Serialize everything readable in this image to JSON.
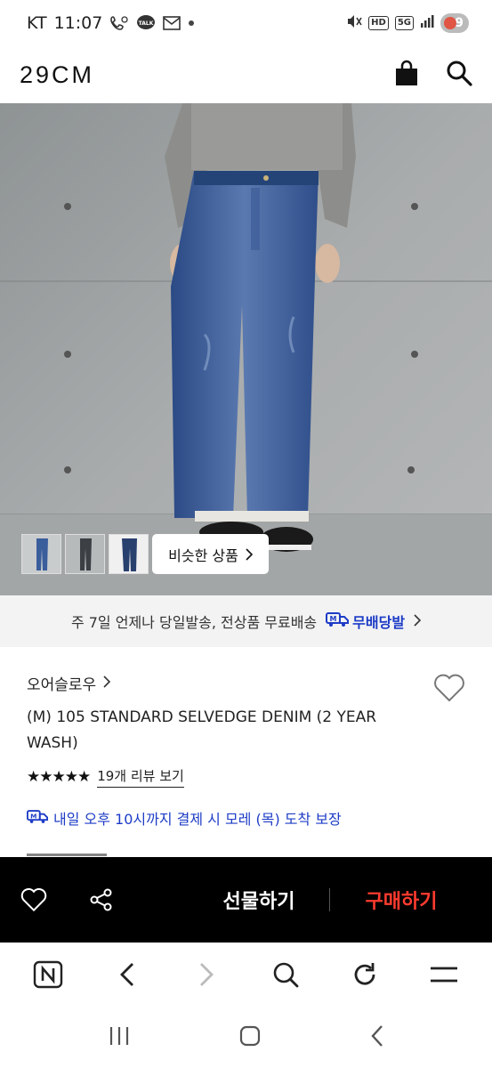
{
  "status_bar": {
    "carrier": "KT",
    "time": "11:07",
    "talk_badge": "TALK",
    "network": "5G",
    "hd_badge": "HD",
    "battery": "9"
  },
  "header": {
    "logo": "29CM",
    "icons": [
      "shopping-bag-icon",
      "search-icon"
    ]
  },
  "hero": {
    "thumbnails": [
      "thumb-blue-jeans",
      "thumb-dark-jeans",
      "thumb-indigo-jeans"
    ],
    "similar_label": "비슷한 상품",
    "similar_chevron": "›"
  },
  "shipping_banner": {
    "text": "주 7일 언제나 당일발송, 전상품 무료배송",
    "brand_label": "무배당발",
    "chevron": "›"
  },
  "product": {
    "brand": "오어슬로우",
    "brand_chevron": "›",
    "title": "(M) 105 STANDARD SELVEDGE DENIM (2 YEAR WASH)",
    "stars": "★★★★★",
    "review_link": "19개 리뷰 보기",
    "delivery_text": "내일 오후 10시까지 결제 시 모레 (목) 도착 보장"
  },
  "action_bar": {
    "gift_label": "선물하기",
    "buy_label": "구매하기"
  },
  "browser_bar": {
    "icons": [
      "naver-icon",
      "back-icon",
      "forward-icon",
      "search-icon",
      "reload-icon",
      "menu-icon"
    ]
  },
  "system_nav": {
    "icons": [
      "recent-apps-icon",
      "home-icon",
      "back-icon"
    ]
  },
  "colors": {
    "accent_blue": "#1d3cc6",
    "buy_red": "#ff3b2f",
    "action_bar_bg": "#000000",
    "banner_bg": "#f3f3f4"
  }
}
